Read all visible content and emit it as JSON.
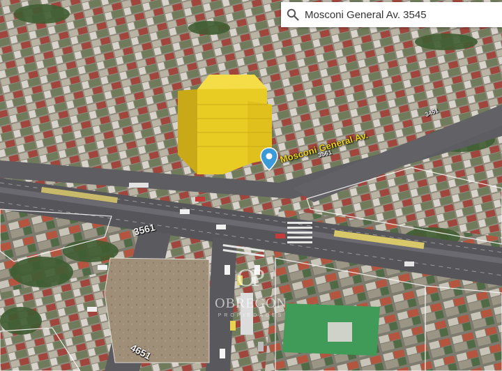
{
  "search": {
    "query": "Mosconi General Av. 3545"
  },
  "map": {
    "street_label": "Mosconi General Av.",
    "address_numbers": [
      "3561",
      "4651",
      "3561",
      "3451"
    ],
    "building_color": "#e9cc23",
    "pin_color": "#3b9ad9"
  },
  "watermark": {
    "name": "OBREGÓN",
    "sub": "PROPIEDADES",
    "logo": "OP"
  },
  "icons": [
    "search-icon",
    "location-pin-icon"
  ]
}
